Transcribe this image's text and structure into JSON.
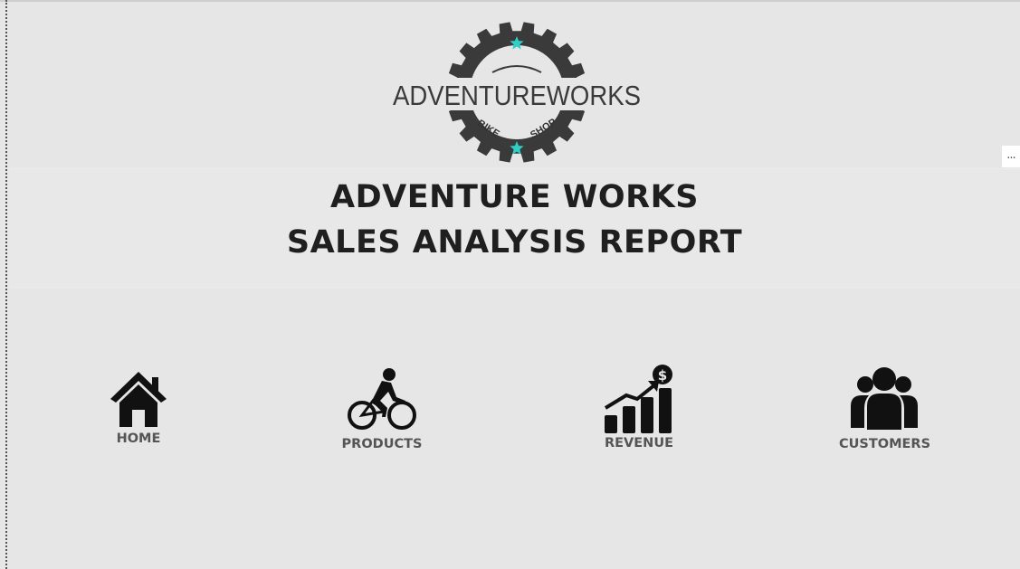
{
  "logo": {
    "brand_text": "ADVENTUREWORKS",
    "sub_left": "BIKE",
    "sub_right": "SHOP",
    "gear_color": "#3a3a3a",
    "star_color": "#2fcfc6"
  },
  "report": {
    "title_line1": "ADVENTURE WORKS",
    "title_line2": "SALES ANALYSIS REPORT"
  },
  "visual_menu": {
    "more_label": "..."
  },
  "nav": {
    "home": {
      "label": "HOME",
      "icon": "house-icon"
    },
    "products": {
      "label": "PRODUCTS",
      "icon": "cyclist-icon"
    },
    "revenue": {
      "label": "REVENUE",
      "icon": "revenue-chart-icon"
    },
    "customers": {
      "label": "CUSTOMERS",
      "icon": "people-group-icon"
    }
  },
  "colors": {
    "background": "#e6e6e6",
    "title_text": "#1f1f1f",
    "nav_label": "#555555",
    "icon_fill": "#111111"
  }
}
